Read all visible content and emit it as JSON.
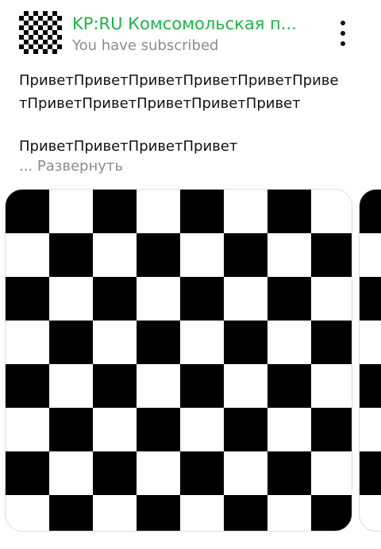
{
  "header": {
    "channel_name": "KP:RU Комсомольская п...",
    "subscription_status": "You have subscribed",
    "avatar_icon": "checkerboard-avatar-icon",
    "more_icon": "vertical-ellipsis-icon",
    "channel_color": "#1fb34a"
  },
  "post": {
    "lines": [
      "ПриветПриветПриветПриветПриветПриве",
      "тПриветПриветПриветПриветПривет",
      "ПриветПриветПриветПривет"
    ],
    "ellipsis": "...",
    "expand_label": "Развернуть"
  },
  "media": {
    "main_icon": "checkerboard-image",
    "next_icon": "checkerboard-image-partial"
  }
}
